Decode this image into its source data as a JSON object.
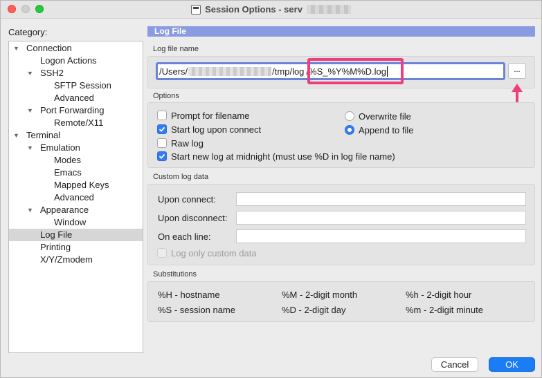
{
  "window": {
    "title": "Session Options - serv"
  },
  "category": {
    "label": "Category:",
    "items": [
      {
        "label": "Connection",
        "level": 0,
        "expanded": true
      },
      {
        "label": "Logon Actions",
        "level": 1
      },
      {
        "label": "SSH2",
        "level": 1,
        "expanded": true
      },
      {
        "label": "SFTP Session",
        "level": 2
      },
      {
        "label": "Advanced",
        "level": 2
      },
      {
        "label": "Port Forwarding",
        "level": 1,
        "expanded": true
      },
      {
        "label": "Remote/X11",
        "level": 2
      },
      {
        "label": "Terminal",
        "level": 0,
        "expanded": true
      },
      {
        "label": "Emulation",
        "level": 1,
        "expanded": true
      },
      {
        "label": "Modes",
        "level": 2
      },
      {
        "label": "Emacs",
        "level": 2
      },
      {
        "label": "Mapped Keys",
        "level": 2
      },
      {
        "label": "Advanced",
        "level": 2
      },
      {
        "label": "Appearance",
        "level": 1,
        "expanded": true
      },
      {
        "label": "Window",
        "level": 2
      },
      {
        "label": "Log File",
        "level": 1,
        "selected": true
      },
      {
        "label": "Printing",
        "level": 1
      },
      {
        "label": "X/Y/Zmodem",
        "level": 1
      }
    ]
  },
  "panel": {
    "header": "Log File",
    "log_file_name": {
      "label": "Log file name",
      "path_prefix": "/Users/",
      "path_middle": "/tmp/log",
      "path_suffix": "/%S_%Y%M%D.log",
      "browse_label": "..."
    },
    "options": {
      "label": "Options",
      "checkboxes": [
        {
          "label": "Prompt for filename",
          "checked": false
        },
        {
          "label": "Start log upon connect",
          "checked": true
        },
        {
          "label": "Raw log",
          "checked": false
        },
        {
          "label": "Start new log at midnight (must use %D in log file name)",
          "checked": true
        }
      ],
      "radios": [
        {
          "label": "Overwrite file",
          "selected": false
        },
        {
          "label": "Append to file",
          "selected": true
        }
      ]
    },
    "custom_log_data": {
      "label": "Custom log data",
      "upon_connect_label": "Upon connect:",
      "upon_connect_value": "",
      "upon_disconnect_label": "Upon disconnect:",
      "upon_disconnect_value": "",
      "on_each_line_label": "On each line:",
      "on_each_line_value": "",
      "log_only_custom_label": "Log only custom data"
    },
    "substitutions": {
      "label": "Substitutions",
      "items": [
        "%H - hostname",
        "%M - 2-digit month",
        "%h - 2-digit hour",
        "%S - session name",
        "%D - 2-digit day",
        "%m - 2-digit minute"
      ]
    }
  },
  "buttons": {
    "cancel": "Cancel",
    "ok": "OK"
  },
  "colors": {
    "accent": "#1a7df5",
    "header": "#8a9be0",
    "annotation": "#ee3f7a"
  }
}
